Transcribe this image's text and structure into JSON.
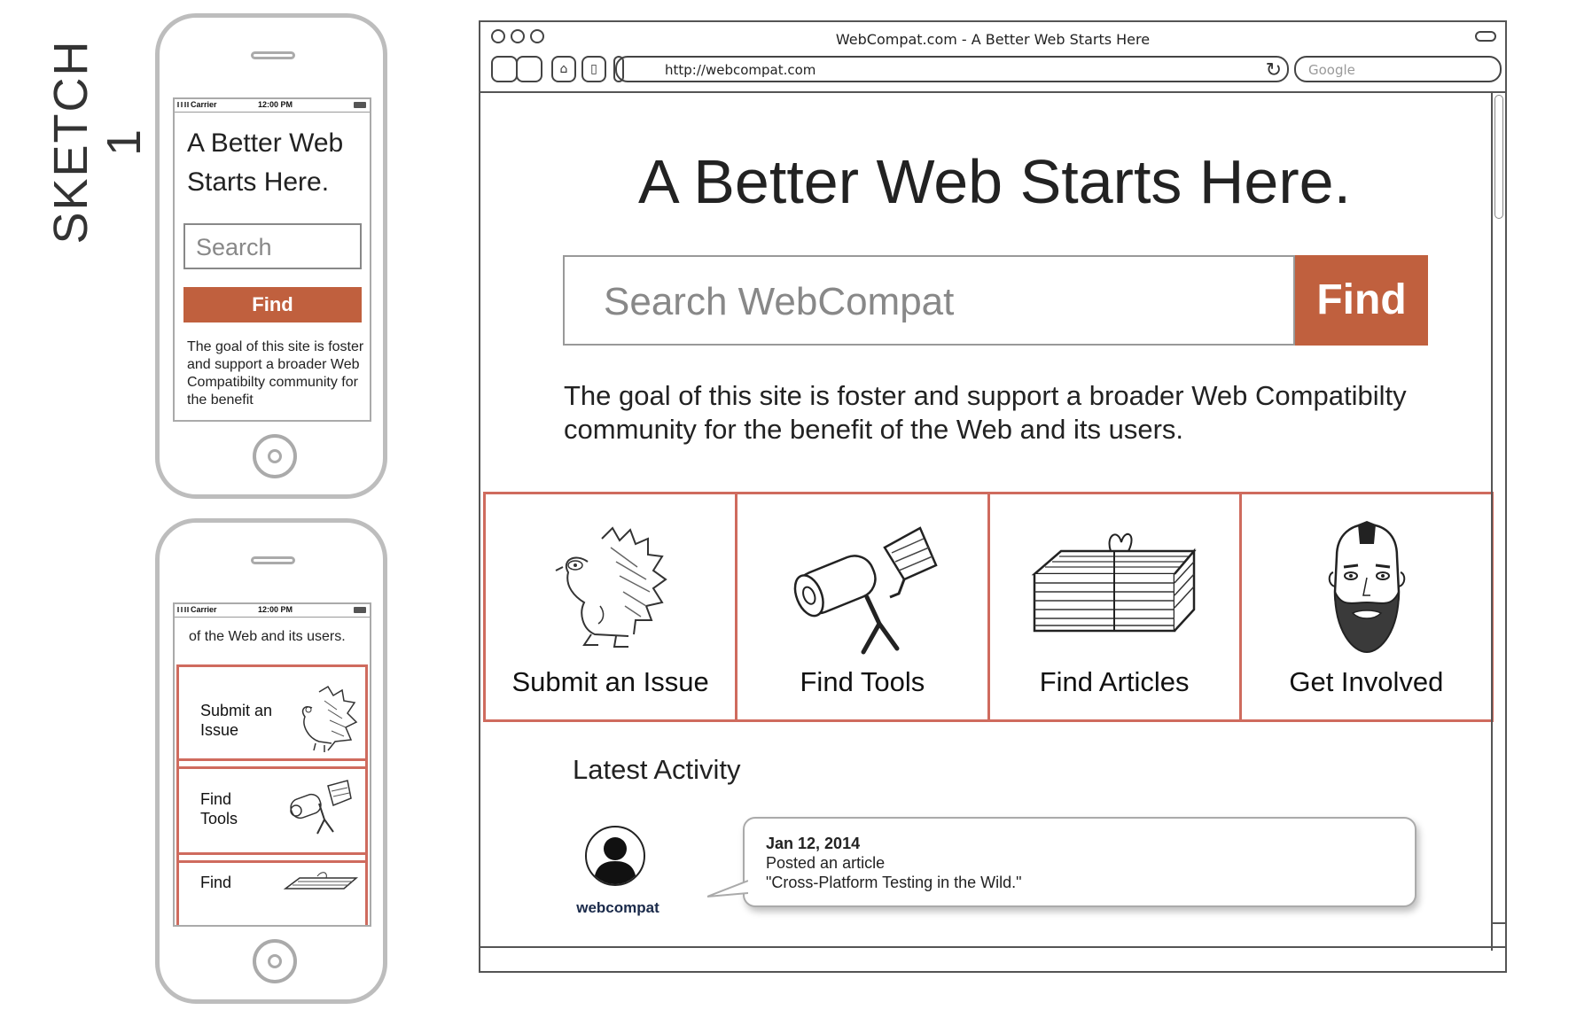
{
  "sketch_label": "SKETCH 1",
  "phone1": {
    "carrier": "Carrier",
    "time": "12:00 PM",
    "title_line1": "A Better Web",
    "title_line2": "Starts Here.",
    "search_placeholder": "Search",
    "find_label": "Find",
    "goal_text": "The goal of this site is foster and support a broader Web Compatibilty community for the benefit"
  },
  "phone2": {
    "carrier": "Carrier",
    "time": "12:00 PM",
    "intro_text": "of the Web and its users.",
    "cards": [
      {
        "line1": "Submit an",
        "line2": "Issue"
      },
      {
        "line1": "Find",
        "line2": "Tools"
      },
      {
        "line1": "Find",
        "line2": ""
      }
    ]
  },
  "browser": {
    "window_title": "WebCompat.com - A Better Web Starts Here",
    "url": "http://webcompat.com",
    "search_engine_placeholder": "Google",
    "hero_title": "A Better Web Starts Here.",
    "search_placeholder": "Search WebCompat",
    "find_label": "Find",
    "goal_text": "The goal of this site is foster and support a broader Web Compatibilty community for the benefit of the Web and its users.",
    "cards": [
      {
        "label": "Submit an Issue",
        "icon": "hedgehog-icon"
      },
      {
        "label": "Find Tools",
        "icon": "paint-roller-icon"
      },
      {
        "label": "Find Articles",
        "icon": "newspaper-stack-icon"
      },
      {
        "label": "Get Involved",
        "icon": "bearded-man-icon"
      }
    ],
    "latest_activity": {
      "title": "Latest Activity",
      "username": "webcompat",
      "date": "Jan 12, 2014",
      "action": "Posted an article",
      "article": "\"Cross-Platform Testing in the Wild.\""
    }
  },
  "colors": {
    "accent": "#c0603e",
    "card_border": "#cf6b5e"
  }
}
